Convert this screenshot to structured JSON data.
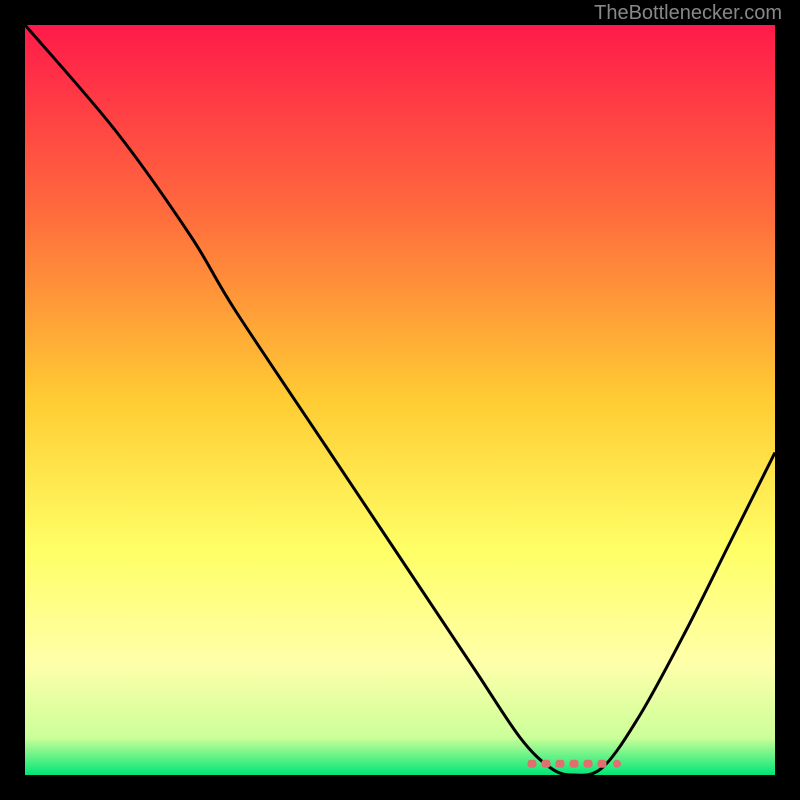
{
  "watermark": "TheBottlenecker.com",
  "chart_data": {
    "type": "line",
    "title": "",
    "xlabel": "",
    "ylabel": "",
    "xlim": [
      0,
      100
    ],
    "ylim": [
      0,
      100
    ],
    "background_gradient": {
      "stops": [
        {
          "offset": 0,
          "color": "#ff1a4a"
        },
        {
          "offset": 25,
          "color": "#ff6b3d"
        },
        {
          "offset": 50,
          "color": "#ffcc33"
        },
        {
          "offset": 70,
          "color": "#ffff66"
        },
        {
          "offset": 85,
          "color": "#ffffaa"
        },
        {
          "offset": 95,
          "color": "#ccff99"
        },
        {
          "offset": 100,
          "color": "#00e676"
        }
      ]
    },
    "curve": {
      "description": "Bottleneck curve with minimum around x=73",
      "points": [
        {
          "x": 0,
          "y": 100
        },
        {
          "x": 12,
          "y": 86
        },
        {
          "x": 22,
          "y": 72
        },
        {
          "x": 28,
          "y": 62
        },
        {
          "x": 40,
          "y": 44
        },
        {
          "x": 52,
          "y": 26
        },
        {
          "x": 60,
          "y": 14
        },
        {
          "x": 66,
          "y": 5
        },
        {
          "x": 70,
          "y": 1
        },
        {
          "x": 73,
          "y": 0
        },
        {
          "x": 77,
          "y": 1
        },
        {
          "x": 82,
          "y": 8
        },
        {
          "x": 88,
          "y": 19
        },
        {
          "x": 94,
          "y": 31
        },
        {
          "x": 100,
          "y": 43
        }
      ]
    },
    "marker_band": {
      "x_start": 67,
      "x_end": 78,
      "y": 1.5,
      "color": "#e07070"
    }
  }
}
